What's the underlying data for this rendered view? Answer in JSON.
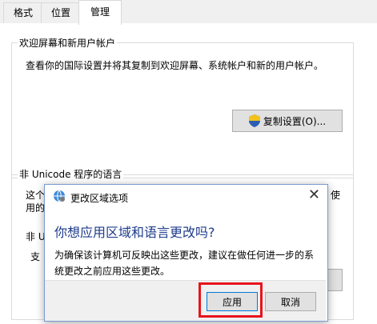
{
  "tabs": [
    {
      "label": "格式"
    },
    {
      "label": "位置"
    },
    {
      "label": "管理"
    }
  ],
  "welcome_group": {
    "title": "欢迎屏幕和新用户帐户",
    "description": "查看你的国际设置并将其复制到欢迎屏幕、系统帐户和新的用户帐户。",
    "copy_button": "复制设置(O)..."
  },
  "unicode_group": {
    "title": "非 Unicode 程序的语言",
    "partial_line1_left": "这个",
    "partial_line1_right": "使",
    "partial_line2_left": "用的",
    "partial_line3_left": "非 U",
    "partial_line4_left": "支"
  },
  "dialog": {
    "title": "更改区域选项",
    "close": "✕",
    "heading": "你想应用区域和语言更改吗?",
    "body": "为确保该计算机可反映出这些更改，建议在做任何进一步的系统更改之前应用这些更改。",
    "apply_button": "应用",
    "cancel_button": "取消"
  },
  "colors": {
    "heading": "#1e3c8c",
    "highlight": "#e8141b"
  }
}
